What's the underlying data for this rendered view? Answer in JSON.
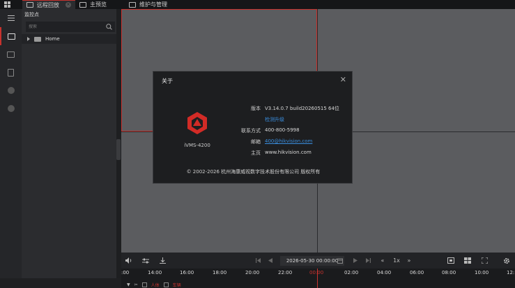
{
  "tabs": [
    {
      "label": "远程回放",
      "active": true
    },
    {
      "label": "主预览",
      "active": false
    },
    {
      "label": "维护与管理",
      "active": false
    }
  ],
  "sidebar": {
    "title": "监控点",
    "search_placeholder": "搜索",
    "tree": [
      {
        "label": "Home"
      }
    ]
  },
  "controls": {
    "date_time": "2026-05-30 00:00:00",
    "speed": "1x"
  },
  "timeline": {
    "labels": [
      ":00",
      "14:00",
      "16:00",
      "18:00",
      "20:00",
      "22:00",
      "00:00",
      "02:00",
      "04:00",
      "06:00",
      "08:00",
      "10:00",
      "12:"
    ],
    "filters": [
      "人体",
      "车辆"
    ]
  },
  "about_dialog": {
    "title": "关于",
    "product": "iVMS-4200",
    "version_label": "版本",
    "version_value": "V3.14.0.7 build20260515 64位",
    "check_update": "检测升级",
    "contact_label": "联系方式",
    "contact_value": "400-800-5998",
    "email_label": "邮箱",
    "email_value": "400@hikvision.com",
    "homepage_label": "主页",
    "homepage_value": "www.hikvision.com",
    "copyright": "© 2002-2026 杭州海康威视数字技术股份有限公司 版权所有"
  },
  "colors": {
    "accent": "#c8322e",
    "link": "#3a8fe0"
  }
}
